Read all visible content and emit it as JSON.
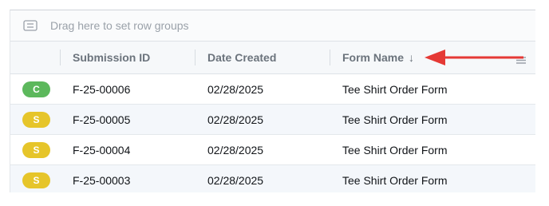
{
  "group_panel": {
    "label": "Drag here to set row groups"
  },
  "columns": [
    {
      "label": ""
    },
    {
      "label": "Submission ID"
    },
    {
      "label": "Date Created"
    },
    {
      "label": "Form Name",
      "sort_icon": "↓"
    }
  ],
  "rows": [
    {
      "status": "C",
      "status_color": "#5cb85c",
      "submission_id": "F-25-00006",
      "date_created": "02/28/2025",
      "form_name": "Tee Shirt Order Form"
    },
    {
      "status": "S",
      "status_color": "#e6c52a",
      "submission_id": "F-25-00005",
      "date_created": "02/28/2025",
      "form_name": "Tee Shirt Order Form"
    },
    {
      "status": "S",
      "status_color": "#e6c52a",
      "submission_id": "F-25-00004",
      "date_created": "02/28/2025",
      "form_name": "Tee Shirt Order Form"
    },
    {
      "status": "S",
      "status_color": "#e6c52a",
      "submission_id": "F-25-00003",
      "date_created": "02/28/2025",
      "form_name": "Tee Shirt Order Form"
    }
  ],
  "annotation": {
    "arrow_color": "#e53935"
  }
}
